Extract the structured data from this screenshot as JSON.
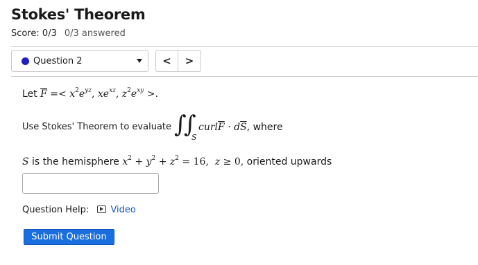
{
  "page": {
    "title": "Stokes' Theorem",
    "score": "Score: 0/3",
    "answered": "0/3 answered"
  },
  "nav": {
    "question_label": "Question 2",
    "prev_label": "<",
    "next_label": ">"
  },
  "question": {
    "let_text": "Let",
    "field_name": "F",
    "field_def": "=< x²e^{yz}, xe^{xz}, z²e^{xy} >.",
    "instruction": "Use Stokes' Theorem to evaluate",
    "integrand": "curl F · dS",
    "integral_region": "S",
    "where": ", where",
    "surface_symbol": "S",
    "surface_desc": "is the hemisphere",
    "equation": "x² + y² + z² = 16,  z ≥ 0,",
    "orientation": "oriented upwards"
  },
  "answer": {
    "value": ""
  },
  "help": {
    "label": "Question Help:",
    "video_label": "Video"
  },
  "actions": {
    "submit_label": "Submit Question"
  },
  "colors": {
    "accent": "#1a6ede",
    "link": "#1a56c6",
    "dot": "#1f1fbf"
  }
}
